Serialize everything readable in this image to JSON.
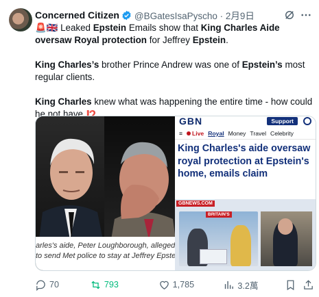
{
  "post": {
    "author_name": "Concerned Citizen",
    "handle_date": "@BGatesIsaPyscho · 2月9日",
    "para1_parts": [
      "🚨🇬🇧 Leaked ",
      "Epstein",
      " Emails show that ",
      "King Charles Aide oversaw Royal protection",
      " for Jeffrey ",
      "Epstein",
      "."
    ],
    "para2_parts": [
      "King Charles’s",
      " brother Prince Andrew was one of ",
      "Epstein’s",
      " most regular clients."
    ],
    "para3_parts": [
      "King Charles",
      " knew what was happening the entire time - how could he not have ",
      "⁉️"
    ]
  },
  "media": {
    "caption_line1": "arles's aide, Peter Loughborough, allegedly ove",
    "caption_line2": "to send Met police to stay at Jeffrey Epstein's h",
    "gb_logo": "GBN",
    "gb_support": "Support",
    "gb_nav": {
      "live": "Live",
      "royal": "Royal",
      "money": "Money",
      "travel": "Travel",
      "celebrity": "Celebrity"
    },
    "gb_headline": "King Charles's aide oversaw royal protection at Epstein's home, emails claim",
    "tv_label": "GBNEWS.COM",
    "tv_show": "BRITAIN'S"
  },
  "actions": {
    "replies": "70",
    "reposts": "793",
    "likes": "1,785",
    "views": "3.2萬"
  },
  "colors": {
    "verified": "#1d9bf0",
    "repost": "#00ba7c",
    "gb_blue": "#12307a",
    "gb_red": "#c81f25"
  }
}
